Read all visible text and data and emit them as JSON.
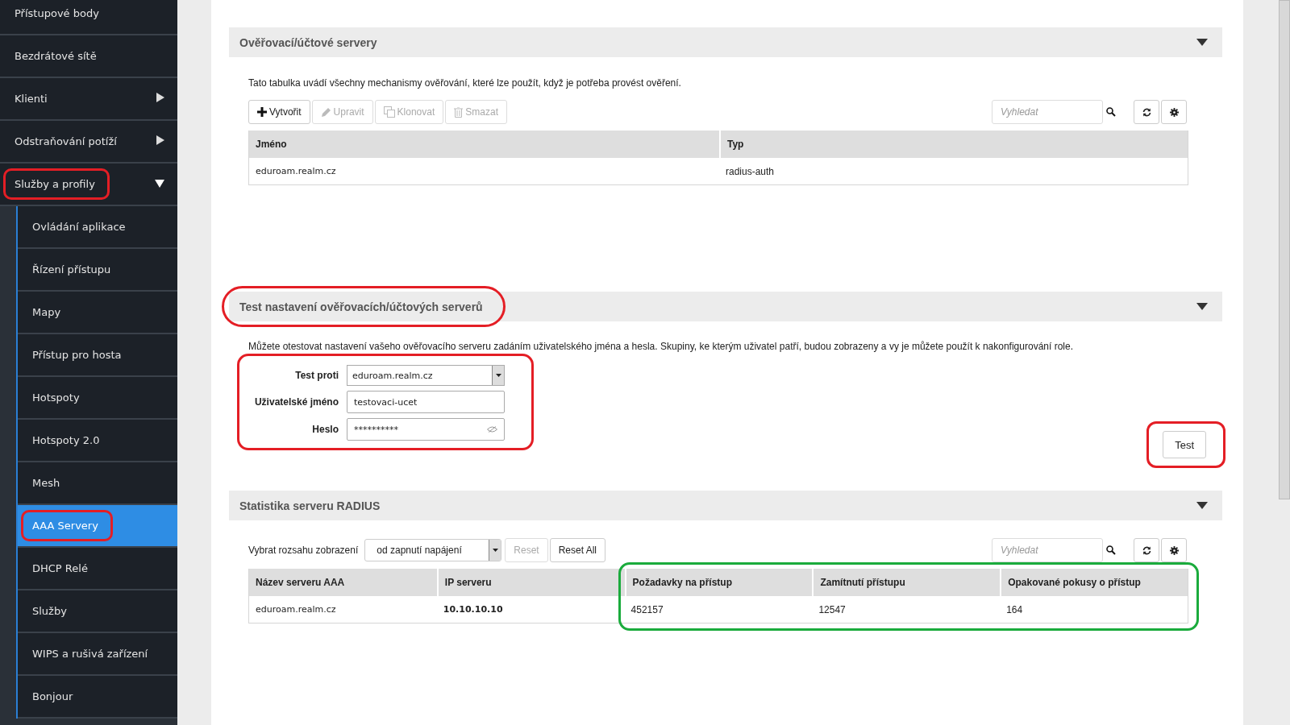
{
  "sidebar": {
    "items": [
      {
        "label": "Přístupové body",
        "circled": false
      },
      {
        "label": "Bezdrátové sítě",
        "circled": false
      },
      {
        "label": "Klienti",
        "expanded": false,
        "circled": false
      },
      {
        "label": "Odstraňování potíží",
        "expanded": false,
        "circled": false
      },
      {
        "label": "Služby a profily",
        "expanded": true,
        "circled": true,
        "children": [
          {
            "label": "Ovládání aplikace",
            "selected": false,
            "circled": false
          },
          {
            "label": "Řízení přístupu",
            "selected": false,
            "circled": false
          },
          {
            "label": "Mapy",
            "selected": false,
            "circled": false
          },
          {
            "label": "Přístup pro hosta",
            "selected": false,
            "circled": false
          },
          {
            "label": "Hotspoty",
            "selected": false,
            "circled": false
          },
          {
            "label": "Hotspoty 2.0",
            "selected": false,
            "circled": false
          },
          {
            "label": "Mesh",
            "selected": false,
            "circled": false
          },
          {
            "label": "AAA Servery",
            "selected": true,
            "circled": true
          },
          {
            "label": "DHCP Relé",
            "selected": false,
            "circled": false
          },
          {
            "label": "Služby",
            "selected": false,
            "circled": false
          },
          {
            "label": "WIPS a rušivá zařízení",
            "selected": false,
            "circled": false
          },
          {
            "label": "Bonjour",
            "selected": false,
            "circled": false
          }
        ]
      }
    ]
  },
  "servers_section": {
    "title": "Ověřovací/účtové servery",
    "expanded": true,
    "description": "Tato tabulka uvádí všechny mechanismy ověřování, které lze použít, když je potřeba provést ověření.",
    "buttons": [
      {
        "label": "Vytvořit",
        "kind": "plus",
        "disabled": false
      },
      {
        "label": "Upravit",
        "kind": "pencil",
        "disabled": true
      },
      {
        "label": "Klonovat",
        "kind": "copy",
        "disabled": true
      },
      {
        "label": "Smazat",
        "kind": "trash",
        "disabled": true
      }
    ],
    "search": {
      "placeholder": "Vyhledat"
    },
    "table": {
      "columns": [
        "Jméno",
        "Typ"
      ],
      "rows": [
        [
          "eduroam.realm.cz",
          "radius-auth"
        ]
      ]
    }
  },
  "test_section": {
    "title": "Test nastavení ověřovacích/účtových serverů",
    "expanded": true,
    "circled": true,
    "description": "Můžete otestovat nastavení vašeho ověřovacího serveru zadáním uživatelského jména a hesla. Skupiny, ke kterým uživatel patří, budou zobrazeny a vy je můžete použít k nakonfigurování role.",
    "form_circled": true,
    "fields": [
      {
        "label": "Test proti",
        "kind": "select",
        "value": "eduroam.realm.cz"
      },
      {
        "label": "Uživatelské jméno",
        "kind": "text",
        "value": "testovaci-ucet"
      },
      {
        "label": "Heslo",
        "kind": "password",
        "value": "**********"
      }
    ],
    "test_button": {
      "label": "Test",
      "circled": true
    }
  },
  "radius_section": {
    "title": "Statistika serveru RADIUS",
    "expanded": true,
    "range_label": "Vybrat rozsahu zobrazení",
    "range_value": "od zapnutí napájení",
    "buttons": [
      {
        "label": "Reset",
        "disabled": true
      },
      {
        "label": "Reset All",
        "disabled": false
      }
    ],
    "search": {
      "placeholder": "Vyhledat"
    },
    "table": {
      "columns": [
        {
          "label": "Název serveru AAA",
          "circled": false
        },
        {
          "label": "IP serveru",
          "circled": false
        },
        {
          "label": "Požadavky na přístup",
          "circled": true
        },
        {
          "label": "Zamítnutí přístupu",
          "circled": true
        },
        {
          "label": "Opakované pokusy o přístup",
          "circled": true
        }
      ],
      "rows": [
        [
          "eduroam.realm.cz",
          "10.10.10.10",
          "452157",
          "12547",
          "164"
        ]
      ]
    }
  }
}
